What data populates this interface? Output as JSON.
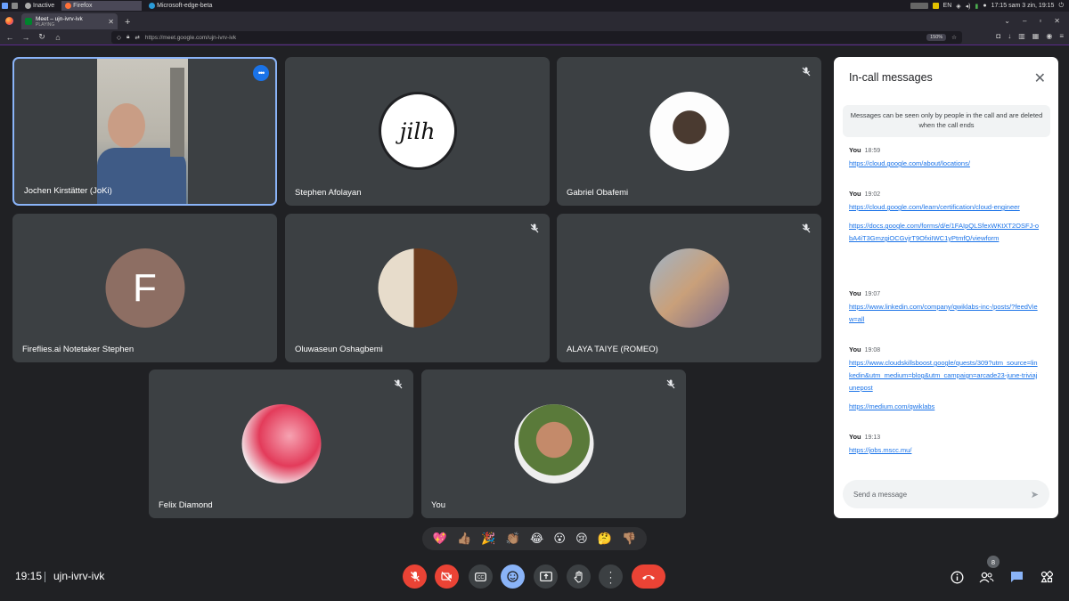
{
  "taskbar": {
    "items": [
      "Inactive",
      "Firefox",
      "Microsoft-edge-beta"
    ],
    "lang": "EN",
    "datetime": "17:15 sam   3 zin, 19:15"
  },
  "browser": {
    "tab_title": "Meet – ujn-ivrv-ivk",
    "tab_status": "PLAYING",
    "url": "https://meet.google.com/ujn-ivrv-ivk",
    "zoom": "150%"
  },
  "participants": [
    {
      "name": "Jochen Kirstätter (JoKi)"
    },
    {
      "name": "Stephen Afolayan",
      "logo_text": "jilh"
    },
    {
      "name": "Gabriel Obafemi"
    },
    {
      "name": "Fireflies.ai Notetaker Stephen",
      "initial": "F"
    },
    {
      "name": "Oluwaseun Oshagbemi"
    },
    {
      "name": "ALAYA TAIYE (ROMEO)"
    },
    {
      "name": "Felix Diamond"
    },
    {
      "name": "You"
    }
  ],
  "chat": {
    "title": "In-call messages",
    "notice": "Messages can be seen only by people in the call and are deleted when the call ends",
    "messages": [
      {
        "sender": "You",
        "time": "18:59",
        "links": [
          "https://cloud.google.com/about/locations/"
        ]
      },
      {
        "sender": "You",
        "time": "19:02",
        "links": [
          "https://cloud.google.com/learn/certification/cloud-engineer",
          "https://docs.google.com/forms/d/e/1FAIpQLSfexWKtXT2OSFJ-obA4iT3GmzgiOCGvjrT9OfxiIWC1yPtmfQ/viewform"
        ]
      },
      {
        "sender": "You",
        "time": "19:07",
        "links": [
          "https://www.linkedin.com/company/qwiklabs-inc-/posts/?feedView=all"
        ]
      },
      {
        "sender": "You",
        "time": "19:08",
        "links": [
          "https://www.cloudskillsboost.google/quests/309?utm_source=linkedin&utm_medium=blog&utm_campaign=arcade23-june-triviajunepost",
          "https://medium.com/qwiklabs"
        ]
      },
      {
        "sender": "You",
        "time": "19:13",
        "links": [
          "https://jobs.mscc.mu/"
        ]
      }
    ],
    "placeholder": "Send a message"
  },
  "reactions": [
    "💖",
    "👍🏽",
    "🎉",
    "👏🏽",
    "😂",
    "😮",
    "😢",
    "🤔",
    "👎🏽"
  ],
  "footer": {
    "time": "19:15",
    "meeting_code": "ujn-ivrv-ivk",
    "participant_count": "8"
  },
  "colors": {
    "accent": "#8ab4f8",
    "danger": "#ea4335",
    "tile": "#3c4043",
    "bg": "#202124"
  }
}
